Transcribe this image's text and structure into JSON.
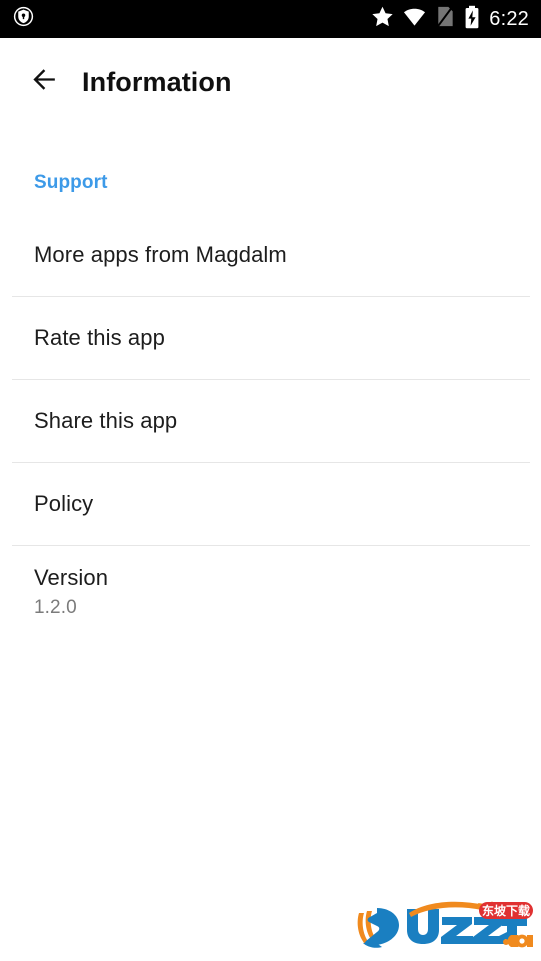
{
  "statusbar": {
    "time": "6:22",
    "left_icons": [
      {
        "name": "shield-notification-icon",
        "glyph": "shield"
      }
    ],
    "right_icons": [
      {
        "name": "star-icon",
        "glyph": "star"
      },
      {
        "name": "wifi-icon",
        "glyph": "wifi"
      },
      {
        "name": "sim-card-missing-icon",
        "glyph": "sim-slash"
      },
      {
        "name": "battery-charging-icon",
        "glyph": "battery-bolt"
      }
    ]
  },
  "appbar": {
    "back_label": "Back",
    "title": "Information"
  },
  "content": {
    "section_header": "Support",
    "items": [
      {
        "title": "More apps from Magdalm",
        "subtitle": ""
      },
      {
        "title": "Rate this app",
        "subtitle": ""
      },
      {
        "title": "Share this app",
        "subtitle": ""
      },
      {
        "title": "Policy",
        "subtitle": ""
      },
      {
        "title": "Version",
        "subtitle": "1.2.0"
      }
    ]
  },
  "watermark": {
    "brand": "UZZF",
    "domain": ".com",
    "badge_text": "东坡下载"
  },
  "colors": {
    "accent_blue": "#3d9ae8",
    "statusbar_bg": "#000000",
    "title_text": "#101010",
    "body_text": "#1d1d1d",
    "subtitle_text": "#7b7b7b",
    "divider": "#e6e6e6",
    "logo_blue": "#1a7fc1",
    "logo_orange": "#f08a1e",
    "logo_red": "#e03131"
  }
}
